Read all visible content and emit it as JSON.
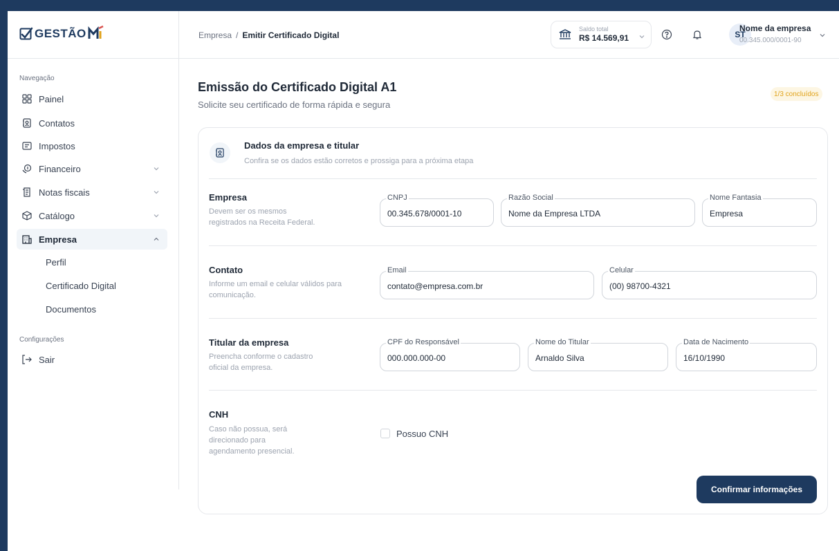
{
  "app": {
    "logo_text": "GESTÃO"
  },
  "sidebar": {
    "nav_section_label": "Navegação",
    "items": [
      {
        "label": "Painel",
        "icon": "grid-icon"
      },
      {
        "label": "Contatos",
        "icon": "contacts-icon"
      },
      {
        "label": "Impostos",
        "icon": "tax-icon"
      },
      {
        "label": "Financeiro",
        "icon": "money-icon"
      },
      {
        "label": "Notas fiscais",
        "icon": "receipt-icon"
      },
      {
        "label": "Catálogo",
        "icon": "box-icon"
      },
      {
        "label": "Empresa",
        "icon": "building-icon"
      }
    ],
    "sub_items": [
      "Perfil",
      "Certificado Digital",
      "Documentos"
    ],
    "settings_section_label": "Configurações",
    "logout_label": "Sair"
  },
  "header": {
    "breadcrumb": {
      "parent": "Empresa",
      "separator": "/",
      "current": "Emitir Certificado Digital"
    },
    "balance": {
      "label": "Saldo total",
      "value": "R$ 14.569,91"
    },
    "avatar_initials": "ST",
    "company": {
      "name": "Nome da empresa",
      "cnpj": "00.345.000/0001-90"
    }
  },
  "page": {
    "title": "Emissão do Certificado Digital A1",
    "subtitle": "Solicite seu certificado de forma rápida e segura",
    "progress": "1/3 concluídos"
  },
  "card": {
    "title": "Dados da empresa e titular",
    "subtitle": "Confira se os dados estão corretos e prossiga para a próxima etapa",
    "sections": {
      "empresa": {
        "title": "Empresa",
        "desc": "Devem ser os mesmos registrados na Receita Federal.",
        "fields": {
          "cnpj": {
            "label": "CNPJ",
            "value": "00.345.678/0001-10"
          },
          "razao": {
            "label": "Razão Social",
            "value": "Nome da Empresa LTDA"
          },
          "fantasia": {
            "label": "Nome Fantasia",
            "value": "Empresa"
          }
        }
      },
      "contato": {
        "title": "Contato",
        "desc": "Informe um email e celular válidos para comunicação.",
        "fields": {
          "email": {
            "label": "Email",
            "value": "contato@empresa.com.br"
          },
          "celular": {
            "label": "Celular",
            "value": "(00) 98700-4321"
          }
        }
      },
      "titular": {
        "title": "Titular da empresa",
        "desc": "Preencha conforme o cadastro oficial da empresa.",
        "fields": {
          "cpf": {
            "label": "CPF do Responsável",
            "value": "000.000.000-00"
          },
          "nome": {
            "label": "Nome do Titular",
            "value": "Arnaldo Silva"
          },
          "nascimento": {
            "label": "Data de Nacimento",
            "value": "16/10/1990"
          }
        }
      },
      "cnh": {
        "title": "CNH",
        "desc": "Caso não possua, será direcionado para agendamento presencial.",
        "checkbox_label": "Possuo CNH",
        "checked": false
      }
    },
    "confirm_button": "Confirmar informações"
  },
  "colors": {
    "primary": "#1e3a5f",
    "badge_text": "#e0a21a",
    "badge_bg": "#fdf6e3"
  }
}
